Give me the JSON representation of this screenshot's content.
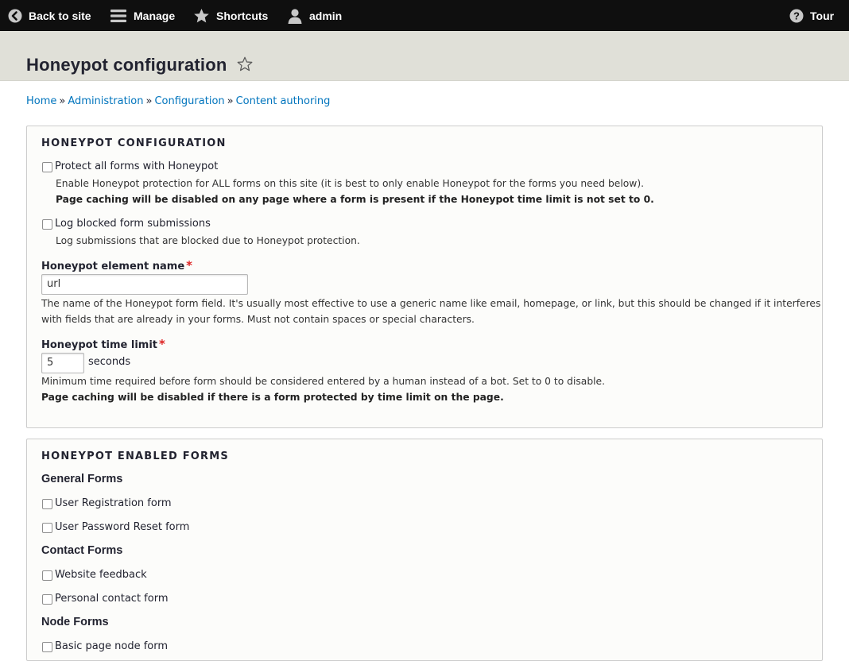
{
  "toolbar": {
    "back": "Back to site",
    "manage": "Manage",
    "shortcuts": "Shortcuts",
    "user": "admin",
    "tour": "Tour"
  },
  "page": {
    "title": "Honeypot configuration"
  },
  "breadcrumb": {
    "home": "Home",
    "administration": "Administration",
    "configuration": "Configuration",
    "content_authoring": "Content authoring",
    "separator": "»"
  },
  "config": {
    "legend": "HONEYPOT CONFIGURATION",
    "protect_all": {
      "label": "Protect all forms with Honeypot",
      "desc": "Enable Honeypot protection for ALL forms on this site (it is best to only enable Honeypot for the forms you need below).",
      "warning": "Page caching will be disabled on any page where a form is present if the Honeypot time limit is not set to 0."
    },
    "log_blocked": {
      "label": "Log blocked form submissions",
      "desc": "Log submissions that are blocked due to Honeypot protection."
    },
    "element_name": {
      "label": "Honeypot element name",
      "required": "*",
      "value": "url",
      "desc_line1": "The name of the Honeypot form field. It's usually most effective to use a generic name like email, homepage, or link, but this should be changed if it interferes",
      "desc_line2": "with fields that are already in your forms. Must not contain spaces or special characters."
    },
    "time_limit": {
      "label": "Honeypot time limit",
      "required": "*",
      "value": "5",
      "suffix": "seconds",
      "desc": "Minimum time required before form should be considered entered by a human instead of a bot. Set to 0 to disable.",
      "warning": "Page caching will be disabled if there is a form protected by time limit on the page."
    }
  },
  "enabled": {
    "legend": "HONEYPOT ENABLED FORMS",
    "general": {
      "heading": "General Forms",
      "user_register": "User Registration form",
      "user_pass": "User Password Reset form"
    },
    "contact": {
      "heading": "Contact Forms",
      "feedback": "Website feedback",
      "personal": "Personal contact form"
    },
    "node": {
      "heading": "Node Forms",
      "basic_page": "Basic page node form"
    }
  }
}
